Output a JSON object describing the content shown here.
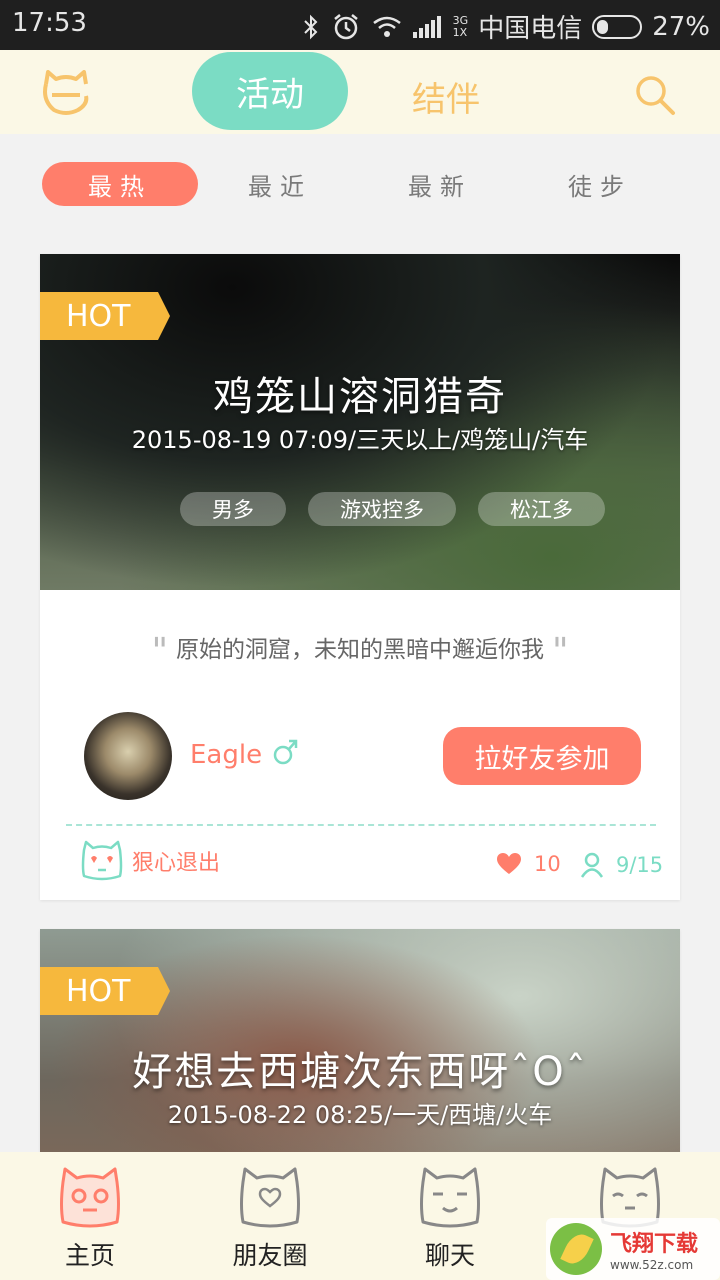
{
  "status_bar": {
    "time": "17:53",
    "network_top": "3G",
    "network_bottom": "1X",
    "carrier": "中国电信",
    "battery_text": "27%",
    "battery_level": 0.27,
    "icons": [
      "bluetooth-icon",
      "alarm-icon",
      "wifi-icon",
      "signal-icon",
      "battery-icon"
    ]
  },
  "header": {
    "logo": "cat-logo-icon",
    "tabs": [
      {
        "label": "活动",
        "active": true
      },
      {
        "label": "结伴",
        "active": false
      }
    ],
    "search_icon": "search-icon"
  },
  "filters": [
    {
      "label": "最热",
      "active": true
    },
    {
      "label": "最近",
      "active": false
    },
    {
      "label": "最新",
      "active": false
    },
    {
      "label": "徒步",
      "active": false
    }
  ],
  "cards": [
    {
      "badge": "HOT",
      "title": "鸡笼山溶洞猎奇",
      "meta": "2015-08-19 07:09/三天以上/鸡笼山/汽车",
      "tags": [
        "男多",
        "游戏控多",
        "松江多"
      ],
      "quote": "原始的洞窟，未知的黑暗中邂逅你我",
      "quote_open": "\"",
      "quote_close": "\"",
      "user": "Eagle",
      "gender": "male",
      "action_label": "拉好友参加",
      "quit_label": "狠心退出",
      "likes": "10",
      "members": "9/15"
    },
    {
      "badge": "HOT",
      "title": "好想去西塘次东西呀ˆOˆ",
      "meta": "2015-08-22 08:25/一天/西塘/火车"
    }
  ],
  "bottom_nav": [
    {
      "label": "主页",
      "icon": "cat-home-icon",
      "active": true
    },
    {
      "label": "朋友圈",
      "icon": "cat-heart-icon",
      "active": false
    },
    {
      "label": "聊天",
      "icon": "cat-chat-icon",
      "active": false
    },
    {
      "label": "",
      "icon": "cat-profile-icon",
      "active": false
    }
  ],
  "watermark": {
    "main": "飞翔下载",
    "url": "www.52z.com"
  },
  "colors": {
    "accent_teal": "#7bdcc4",
    "accent_coral": "#ff7e6b",
    "badge_yellow": "#f6b83d",
    "header_bg": "#fbf8e6"
  }
}
